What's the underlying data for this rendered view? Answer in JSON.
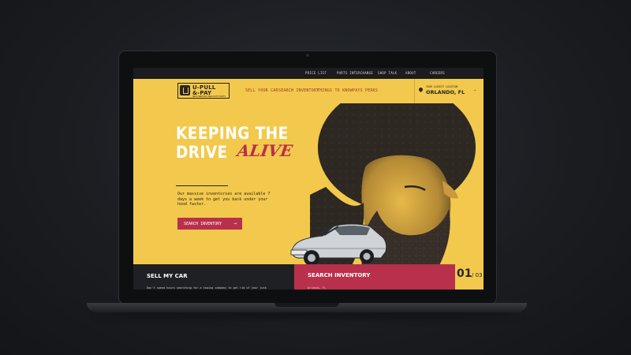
{
  "utility_nav": [
    "PRICE LIST",
    "PARTS INTERCHANGE",
    "SHOP TALK",
    "ABOUT",
    "CAREERS"
  ],
  "logo": {
    "line1": "U-PULL",
    "line2": "&-PAY",
    "tagline": "SELF-SERVICE USED AUTO PARTS"
  },
  "main_nav": [
    "SELL YOUR CAR",
    "SEARCH INVENTORY",
    "THINGS TO KNOW",
    "PAYS PERKS"
  ],
  "location": {
    "label": "YOUR CLOSEST LOCATION",
    "city": "ORLANDO, FL",
    "chevron": "⌄"
  },
  "hero": {
    "title_line1": "KEEPING THE",
    "title_line2": "DRIVE",
    "title_accent": "ALIVE",
    "description": "Our massive inventories are available 7 days a week to get you back under your hood faster.",
    "cta": "SEARCH INVENTORY",
    "cta_arrow": "→"
  },
  "slider": {
    "prev": "←",
    "next": "→",
    "current": "01",
    "total": "/ 03"
  },
  "sell": {
    "title": "SELL MY CAR",
    "text": "Don't spend hours searching for a towing company to get rid of your junk"
  },
  "search": {
    "title": "SEARCH INVENTORY",
    "sub": "Orlando, FL"
  },
  "colors": {
    "yellow": "#f2c94c",
    "red": "#b8304c",
    "dark": "#1e2024"
  }
}
